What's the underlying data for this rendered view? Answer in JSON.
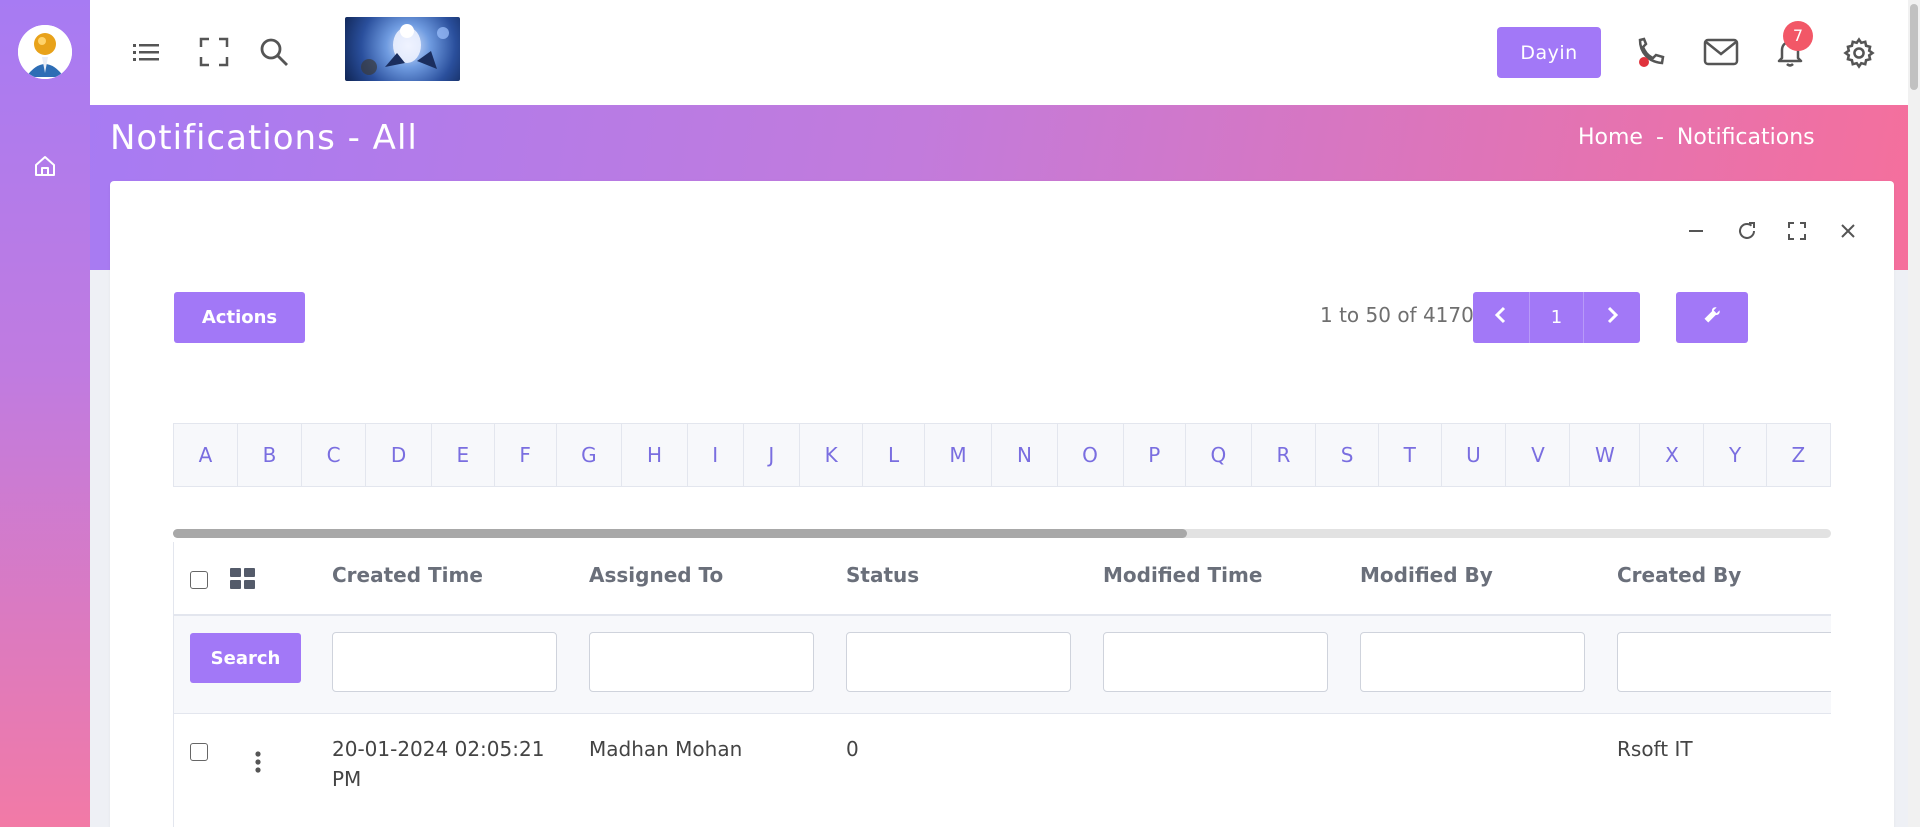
{
  "header": {
    "dayin_label": "Dayin",
    "notification_count": "7"
  },
  "page": {
    "title": "Notifications - All",
    "breadcrumb": [
      "Home",
      "-",
      "Notifications"
    ]
  },
  "toolbar": {
    "actions_label": "Actions",
    "page_info": "1 to 50 of 4170",
    "current_page": "1"
  },
  "alphabet": [
    "A",
    "B",
    "C",
    "D",
    "E",
    "F",
    "G",
    "H",
    "I",
    "J",
    "K",
    "L",
    "M",
    "N",
    "O",
    "P",
    "Q",
    "R",
    "S",
    "T",
    "U",
    "V",
    "W",
    "X",
    "Y",
    "Z"
  ],
  "table": {
    "columns": [
      "Created Time",
      "Assigned To",
      "Status",
      "Modified Time",
      "Modified By",
      "Created By"
    ],
    "search_label": "Search",
    "rows": [
      {
        "created_time": "20-01-2024 02:05:21 PM",
        "assigned_to": "Madhan Mohan",
        "status": "0",
        "modified_time": "",
        "modified_by": "",
        "created_by": "Rsoft IT"
      }
    ]
  },
  "colors": {
    "accent": "#a278f7",
    "gradient_start": "#a77bf3",
    "gradient_end": "#f56f9c",
    "badge": "#f25767"
  }
}
